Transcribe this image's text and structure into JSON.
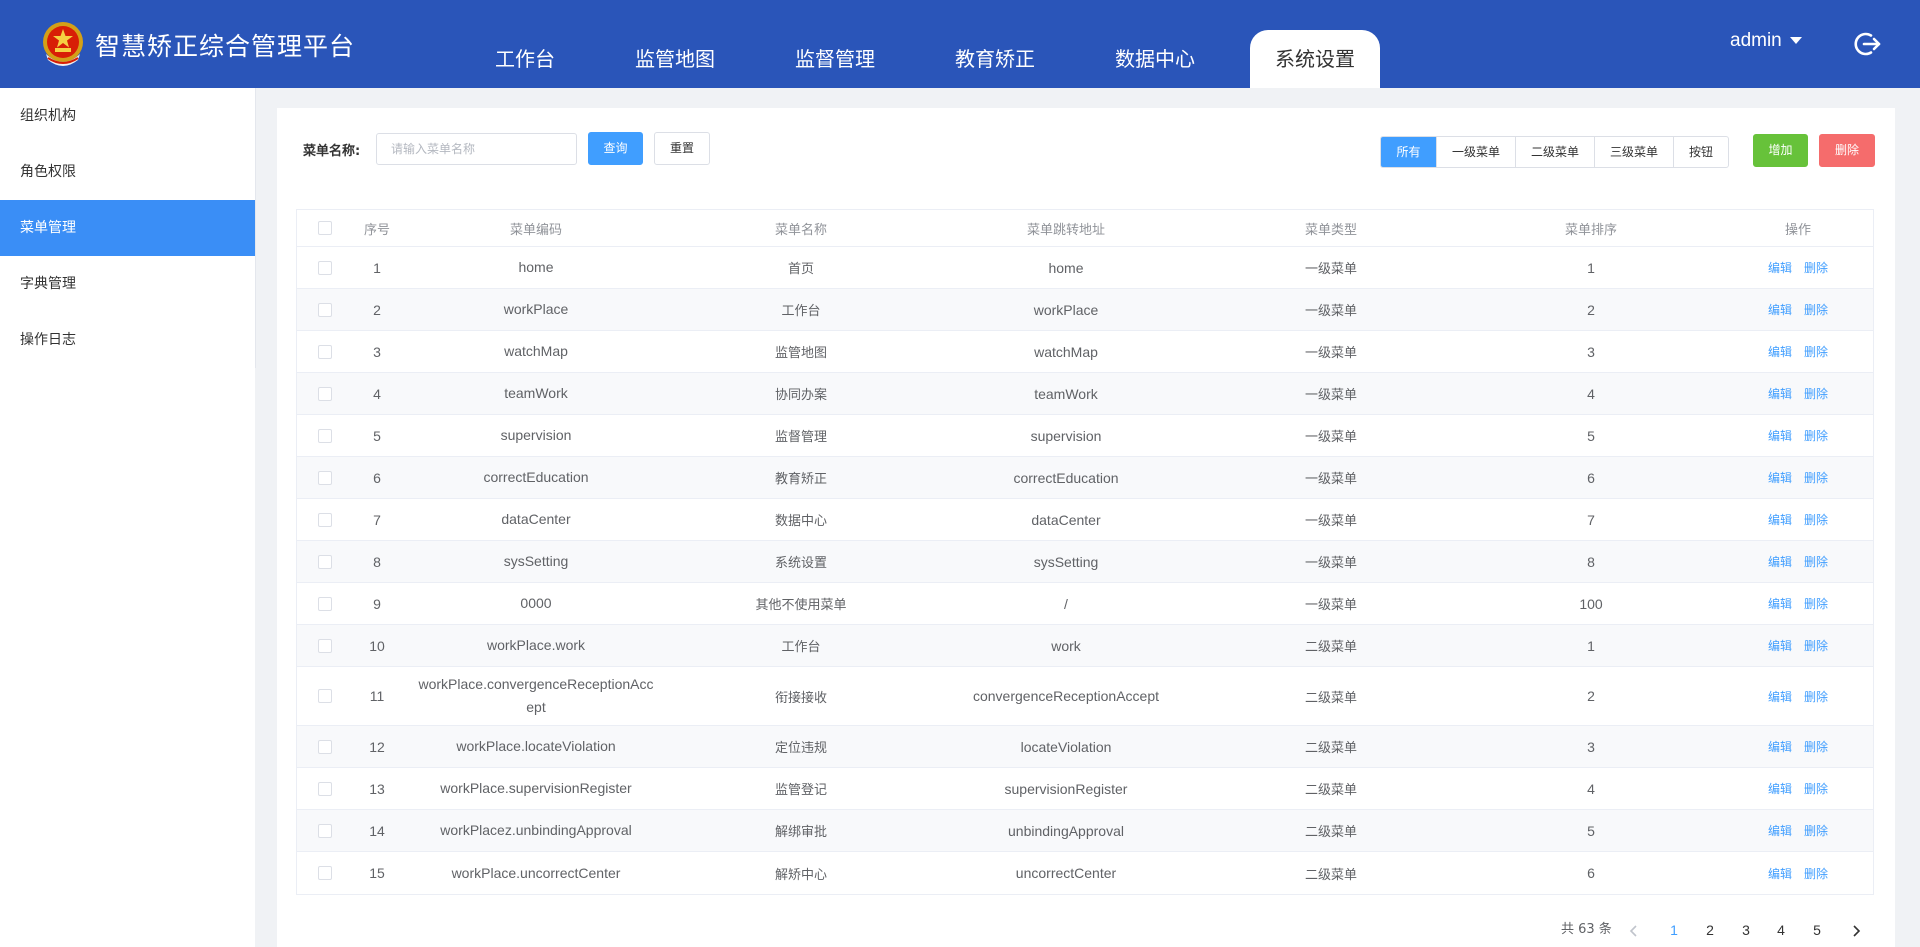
{
  "header": {
    "app_title": "智慧矫正综合管理平台",
    "nav": [
      {
        "label": "工作台",
        "active": false
      },
      {
        "label": "监管地图",
        "active": false
      },
      {
        "label": "监督管理",
        "active": false
      },
      {
        "label": "教育矫正",
        "active": false
      },
      {
        "label": "数据中心",
        "active": false
      },
      {
        "label": "系统设置",
        "active": true
      }
    ],
    "user": "admin",
    "logout_icon": "logout-icon",
    "colors": {
      "primary": "#2a55b9"
    }
  },
  "sidebar": {
    "items": [
      {
        "label": "组织机构",
        "active": false
      },
      {
        "label": "角色权限",
        "active": false
      },
      {
        "label": "菜单管理",
        "active": true
      },
      {
        "label": "字典管理",
        "active": false
      },
      {
        "label": "操作日志",
        "active": false
      }
    ]
  },
  "toolbar": {
    "search_label": "菜单名称:",
    "search_placeholder": "请输入菜单名称",
    "search_value": "",
    "query_label": "查询",
    "reset_label": "重置",
    "filters": [
      {
        "label": "所有",
        "active": true
      },
      {
        "label": "一级菜单",
        "active": false
      },
      {
        "label": "二级菜单",
        "active": false
      },
      {
        "label": "三级菜单",
        "active": false
      },
      {
        "label": "按钮",
        "active": false
      }
    ],
    "add_label": "增加",
    "delete_label": "删除"
  },
  "table": {
    "headers": [
      "序号",
      "菜单编码",
      "菜单名称",
      "菜单跳转地址",
      "菜单类型",
      "菜单排序",
      "操作"
    ],
    "edit_label": "编辑",
    "delete_label": "删除",
    "rows": [
      [
        "1",
        "home",
        "首页",
        "home",
        "一级菜单",
        "1"
      ],
      [
        "2",
        "workPlace",
        "工作台",
        "workPlace",
        "一级菜单",
        "2"
      ],
      [
        "3",
        "watchMap",
        "监管地图",
        "watchMap",
        "一级菜单",
        "3"
      ],
      [
        "4",
        "teamWork",
        "协同办案",
        "teamWork",
        "一级菜单",
        "4"
      ],
      [
        "5",
        "supervision",
        "监督管理",
        "supervision",
        "一级菜单",
        "5"
      ],
      [
        "6",
        "correctEducation",
        "教育矫正",
        "correctEducation",
        "一级菜单",
        "6"
      ],
      [
        "7",
        "dataCenter",
        "数据中心",
        "dataCenter",
        "一级菜单",
        "7"
      ],
      [
        "8",
        "sysSetting",
        "系统设置",
        "sysSetting",
        "一级菜单",
        "8"
      ],
      [
        "9",
        "0000",
        "其他不使用菜单",
        "/",
        "一级菜单",
        "100"
      ],
      [
        "10",
        "workPlace.work",
        "工作台",
        "work",
        "二级菜单",
        "1"
      ],
      [
        "11",
        "workPlace.convergenceReceptionAccept",
        "衔接接收",
        "convergenceReceptionAccept",
        "二级菜单",
        "2"
      ],
      [
        "12",
        "workPlace.locateViolation",
        "定位违规",
        "locateViolation",
        "二级菜单",
        "3"
      ],
      [
        "13",
        "workPlace.supervisionRegister",
        "监管登记",
        "supervisionRegister",
        "二级菜单",
        "4"
      ],
      [
        "14",
        "workPlacez.unbindingApproval",
        "解绑审批",
        "unbindingApproval",
        "二级菜单",
        "5"
      ],
      [
        "15",
        "workPlace.uncorrectCenter",
        "解矫中心",
        "uncorrectCenter",
        "二级菜单",
        "6"
      ]
    ]
  },
  "pagination": {
    "total_label": "共 63 条",
    "prev_icon": "chevron-left-icon",
    "next_icon": "chevron-right-icon",
    "pages": [
      {
        "label": "1",
        "active": true
      },
      {
        "label": "2",
        "active": false
      },
      {
        "label": "3",
        "active": false
      },
      {
        "label": "4",
        "active": false
      },
      {
        "label": "5",
        "active": false
      }
    ]
  }
}
